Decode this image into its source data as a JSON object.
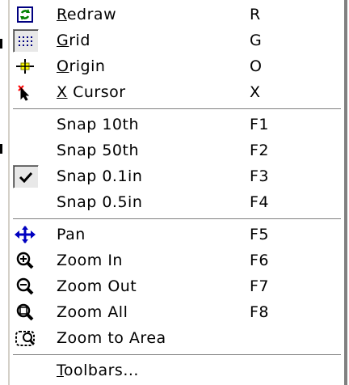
{
  "menu": {
    "items": [
      {
        "pre": "",
        "mn": "R",
        "post": "edraw",
        "accel": "R",
        "icon": "redraw-icon"
      },
      {
        "pre": "",
        "mn": "G",
        "post": "rid",
        "accel": "G",
        "icon": "grid-icon"
      },
      {
        "pre": "",
        "mn": "O",
        "post": "rigin",
        "accel": "O",
        "icon": "origin-icon"
      },
      {
        "pre": "",
        "mn": "X",
        "post": " Cursor",
        "accel": "X",
        "icon": "x-cursor-icon"
      },
      {
        "label": "Snap 10th",
        "accel": "F1"
      },
      {
        "label": "Snap 50th",
        "accel": "F2"
      },
      {
        "label": "Snap 0.1in",
        "accel": "F3",
        "icon": "checkmark-icon"
      },
      {
        "label": "Snap 0.5in",
        "accel": "F4"
      },
      {
        "label": "Pan",
        "accel": "F5",
        "icon": "pan-icon"
      },
      {
        "label": "Zoom In",
        "accel": "F6",
        "icon": "zoom-in-icon"
      },
      {
        "label": "Zoom Out",
        "accel": "F7",
        "icon": "zoom-out-icon"
      },
      {
        "label": "Zoom All",
        "accel": "F8",
        "icon": "zoom-all-icon"
      },
      {
        "label": "Zoom to Area",
        "accel": "",
        "icon": "zoom-to-area-icon"
      },
      {
        "pre": "",
        "mn": "T",
        "post": "oolbars...",
        "accel": "",
        "icon": ""
      }
    ]
  }
}
